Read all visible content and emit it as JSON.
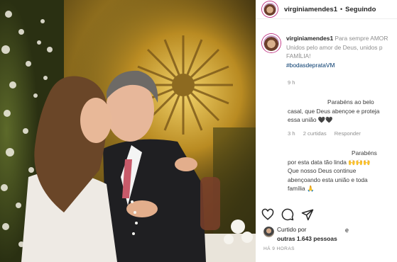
{
  "header": {
    "username": "virginiamendes1",
    "separator": "•",
    "follow_status": "Seguindo"
  },
  "caption": {
    "username": "virginiamendes1",
    "line1": " Para sempre AMOR",
    "line2": "Unidos pelo amor de Deus, unidos p",
    "line3": "FAMÍLIA!",
    "hashtag": "#bodasdeprataVM",
    "time": "9 h"
  },
  "comments": [
    {
      "line1": "Parabéns ao belo",
      "line2": "casal, que Deus abençoe e proteja",
      "line3": "essa união 🖤🖤",
      "time": "3 h",
      "likes": "2 curtidas",
      "reply": "Responder"
    },
    {
      "line1": "Parabéns",
      "line2": "por esta data tão linda 🙌🙌🙌",
      "line3": "Que nosso Deus continue",
      "line4": "abençoando esta união e toda",
      "line5": "família 🙏"
    }
  ],
  "actions": {
    "like_icon": "heart-icon",
    "comment_icon": "comment-icon",
    "share_icon": "share-icon"
  },
  "likes": {
    "line1": "Curtido por",
    "separator": "e",
    "line2": "outras 1.643 pessoas"
  },
  "timestamp": "HÁ 9 HORAS"
}
